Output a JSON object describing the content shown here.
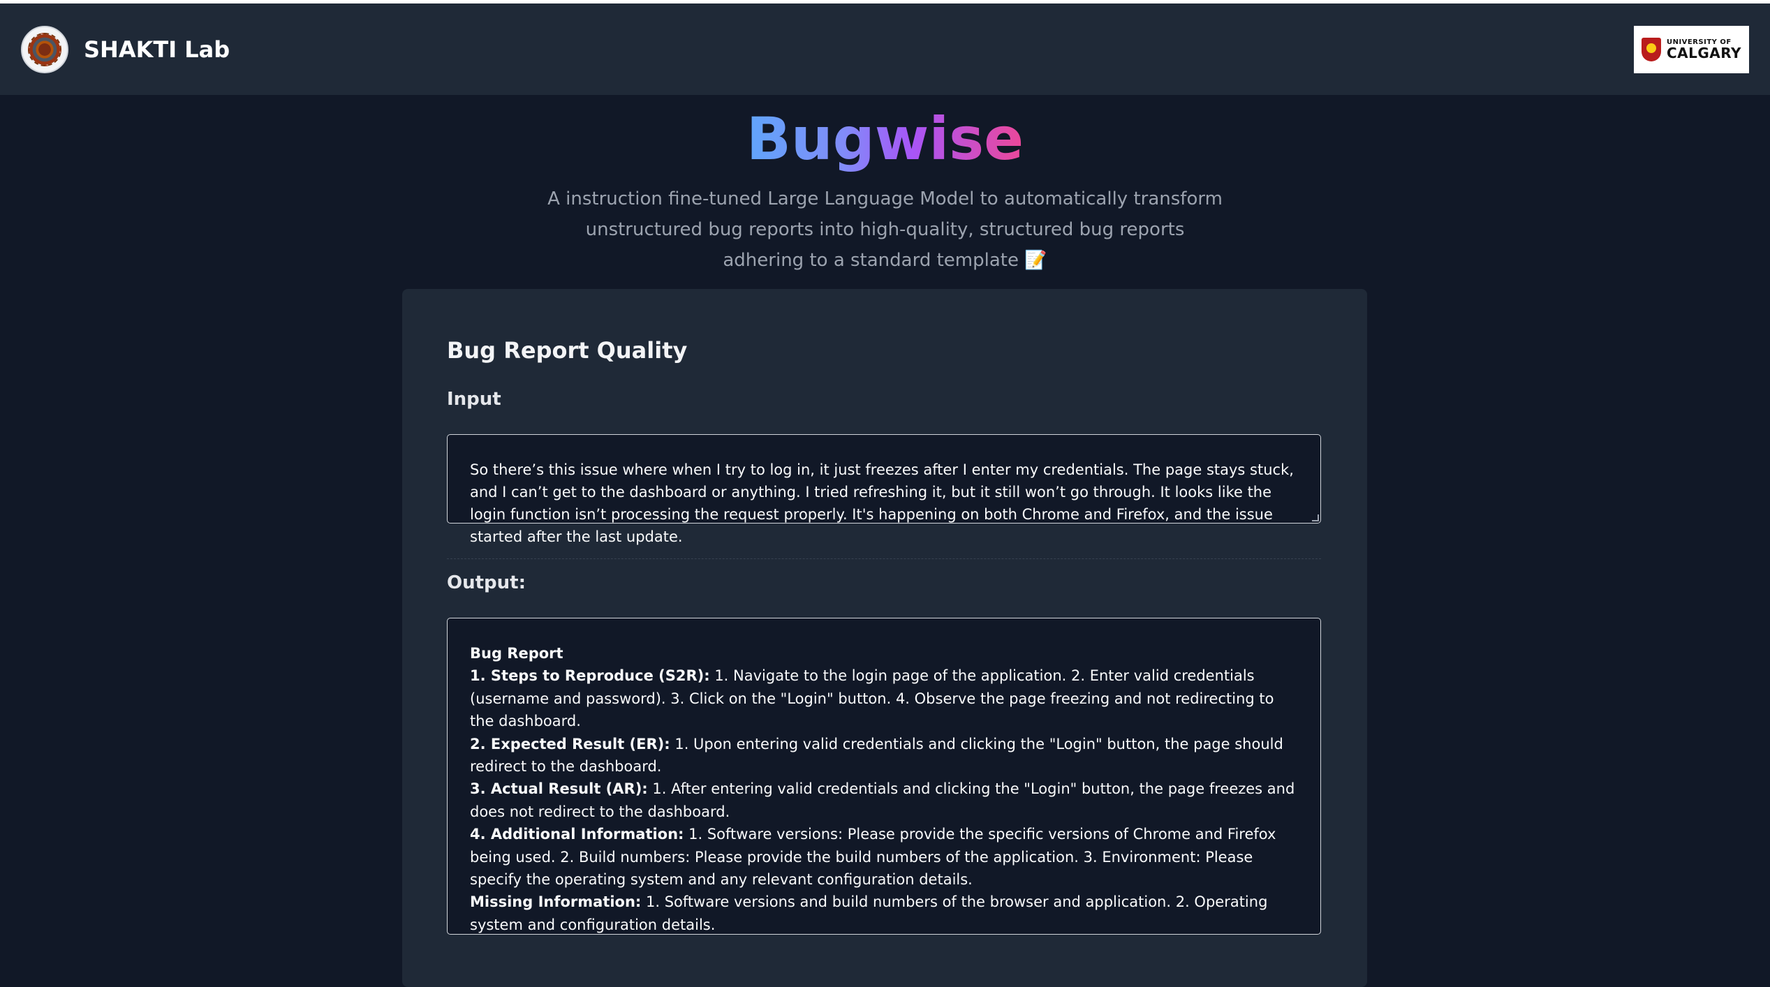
{
  "header": {
    "lab_name": "SHAKTI Lab",
    "partner_logo_line1": "UNIVERSITY OF",
    "partner_logo_line2": "CALGARY"
  },
  "hero": {
    "title": "Bugwise",
    "subtitle": "A instruction fine-tuned Large Language Model to automatically transform unstructured bug reports into high-quality, structured bug reports adhering to a standard template 📝"
  },
  "card": {
    "title": "Bug Report Quality",
    "input_label": "Input",
    "input_value": "So there’s this issue where when I try to log in, it just freezes after I enter my credentials. The page stays stuck, and I can’t get to the dashboard or anything. I tried refreshing it, but it still won’t go through. It looks like the login function isn’t processing the request properly. It's happening on both Chrome and Firefox, and the issue started after the last update.",
    "output_label": "Output:",
    "output": {
      "heading": "Bug Report",
      "s2r_label": "1. Steps to Reproduce (S2R):",
      "s2r_text": " 1. Navigate to the login page of the application. 2. Enter valid credentials (username and password). 3. Click on the \"Login\" button. 4. Observe the page freezing and not redirecting to the dashboard.",
      "er_label": "2. Expected Result (ER):",
      "er_text": " 1. Upon entering valid credentials and clicking the \"Login\" button, the page should redirect to the dashboard.",
      "ar_label": "3. Actual Result (AR):",
      "ar_text": " 1. After entering valid credentials and clicking the \"Login\" button, the page freezes and does not redirect to the dashboard.",
      "ai_label": "4. Additional Information:",
      "ai_text": " 1. Software versions: Please provide the specific versions of Chrome and Firefox being used. 2. Build numbers: Please provide the build numbers of the application. 3. Environment: Please specify the operating system and any relevant configuration details.",
      "mi_label": "Missing Information:",
      "mi_text": " 1. Software versions and build numbers of the browser and application. 2. Operating system and configuration details."
    }
  }
}
